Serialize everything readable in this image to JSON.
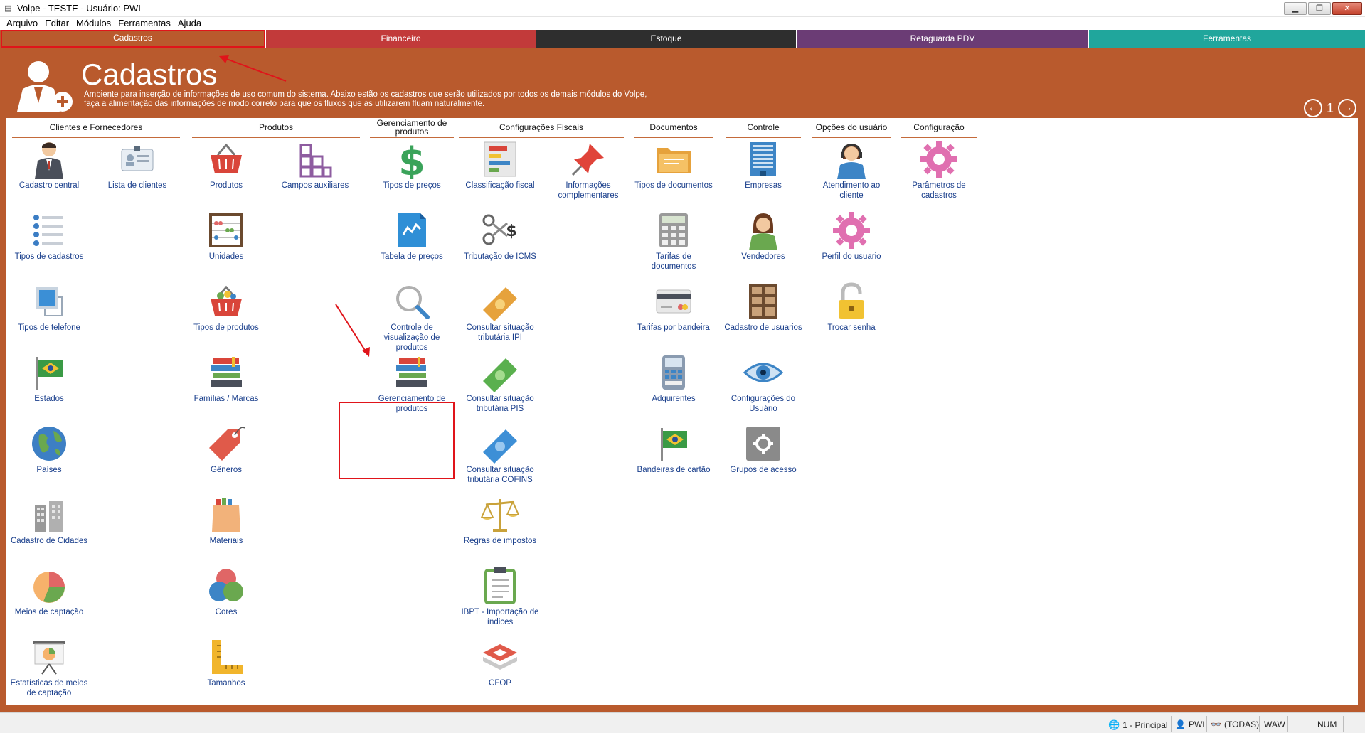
{
  "window": {
    "title": "Volpe - TESTE - Usuário: PWI",
    "min": "▁",
    "max": "❐",
    "close": "✕"
  },
  "menu": [
    "Arquivo",
    "Editar",
    "Módulos",
    "Ferramentas",
    "Ajuda"
  ],
  "tabs": [
    {
      "label": "Cadastros",
      "color": "#b95a2d"
    },
    {
      "label": "Financeiro",
      "color": "#c23a3a"
    },
    {
      "label": "Estoque",
      "color": "#2e2e2e"
    },
    {
      "label": "Retaguarda PDV",
      "color": "#6b3c75"
    },
    {
      "label": "Ferramentas",
      "color": "#20a69c"
    }
  ],
  "header": {
    "title": "Cadastros",
    "desc1": "Ambiente para inserção de informações de uso comum do sistema. Abaixo estão os cadastros que serão utilizados por todos os demais módulos do Volpe,",
    "desc2": "faça a alimentação das informações de modo correto para que os fluxos que as utilizarem fluam naturalmente."
  },
  "pager": {
    "page": "1",
    "prev": "←",
    "next": "→"
  },
  "columns": [
    "Clientes e Fornecedores",
    "Produtos",
    "Gerenciamento de produtos",
    "Configurações Fiscais",
    "Documentos",
    "Controle",
    "Opções do usuário",
    "Configuração"
  ],
  "items": {
    "cadastro_central": "Cadastro central",
    "lista_clientes": "Lista de clientes",
    "tipos_cadastros": "Tipos de cadastros",
    "tipos_telefone": "Tipos de telefone",
    "estados": "Estados",
    "paises": "Países",
    "cadastro_cidades": "Cadastro de Cidades",
    "meios_captacao": "Meios de captação",
    "estatisticas": "Estatísticas de meios de captação",
    "produtos": "Produtos",
    "campos_auxiliares": "Campos auxiliares",
    "unidades": "Unidades",
    "tipos_produtos": "Tipos de produtos",
    "familias": "Famílias / Marcas",
    "generos": "Gêneros",
    "materiais": "Materiais",
    "cores": "Cores",
    "tamanhos": "Tamanhos",
    "tipos_precos": "Tipos de preços",
    "tabela_precos": "Tabela de preços",
    "controle_visualizacao": "Controle de visualização de produtos",
    "gerenciamento_produtos": "Gerenciamento de produtos",
    "classificacao_fiscal": "Classificação fiscal",
    "informacoes_complementares": "Informações complementares",
    "tributacao_icms": "Tributação de ICMS",
    "consultar_ipi": "Consultar situação tributária IPI",
    "consultar_pis": "Consultar situação tributária PIS",
    "consultar_cofins": "Consultar situação tributária COFINS",
    "regras_impostos": "Regras de impostos",
    "ibpt": "IBPT - Importação de índices",
    "cfop": "CFOP",
    "tipos_documentos": "Tipos de documentos",
    "tarifas_documentos": "Tarifas de documentos",
    "tarifas_bandeira": "Tarifas por bandeira",
    "adquirentes": "Adquirentes",
    "bandeiras_cartao": "Bandeiras de cartão",
    "empresas": "Empresas",
    "vendedores": "Vendedores",
    "cadastro_usuarios": "Cadastro de usuarios",
    "configuracoes_usuario": "Configurações do Usuário",
    "grupos_acesso": "Grupos de acesso",
    "atendimento": "Atendimento ao cliente",
    "perfil_usuario": "Perfil do usuario",
    "trocar_senha": "Trocar senha",
    "parametros_cadastros": "Parâmetros de cadastros"
  },
  "status": {
    "principal": "1 - Principal",
    "user": "PWI",
    "todas": "(TODAS)",
    "waw": "WAW",
    "num": "NUM"
  }
}
